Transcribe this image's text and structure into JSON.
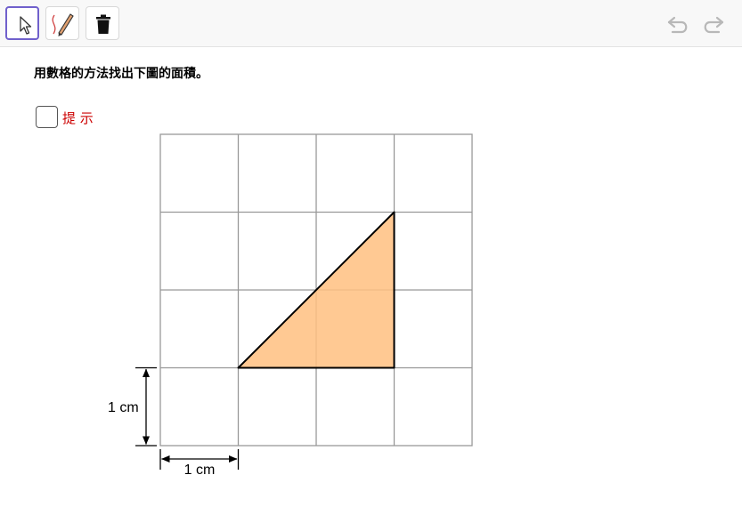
{
  "toolbar": {
    "tools": [
      {
        "name": "move-tool",
        "icon": "arrow-pointer-icon",
        "selected": true
      },
      {
        "name": "pen-tool",
        "icon": "pen-icon",
        "selected": false
      },
      {
        "name": "delete-tool",
        "icon": "trash-icon",
        "selected": false
      }
    ],
    "history": [
      {
        "name": "undo",
        "icon": "undo-icon"
      },
      {
        "name": "redo",
        "icon": "redo-icon"
      }
    ]
  },
  "question": {
    "prompt": "用數格的方法找出下圖的面積。"
  },
  "hint": {
    "label": "提 示",
    "checked": false
  },
  "figure": {
    "grid_columns": 4,
    "grid_rows": 4,
    "triangle_fill": "#ffbf80",
    "vertical_dimension": "1 cm",
    "horizontal_dimension": "1 cm"
  },
  "colors": {
    "accent": "#7060cc",
    "hint_text": "#cc0000",
    "grid_line": "#999999"
  }
}
